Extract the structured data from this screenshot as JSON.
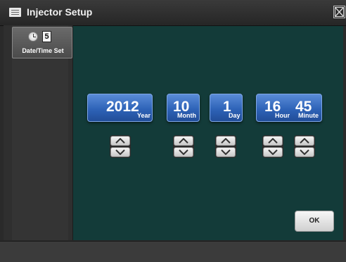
{
  "window": {
    "title": "Injector Setup"
  },
  "sidebar": {
    "items": [
      {
        "label": "Date/Time Set",
        "calendar_digit": "5"
      }
    ]
  },
  "datetime": {
    "year": {
      "value": "2012",
      "unit": "Year"
    },
    "month": {
      "value": "10",
      "unit": "Month"
    },
    "day": {
      "value": "1",
      "unit": "Day"
    },
    "hour": {
      "value": "16",
      "unit": "Hour"
    },
    "minute": {
      "value": "45",
      "unit": "Minute"
    }
  },
  "actions": {
    "ok_label": "OK"
  },
  "colors": {
    "main_background": "#133b39",
    "field_blue": "#2e63b8",
    "titlebar": "#2f2f2f"
  },
  "icons": [
    "list-icon",
    "close-icon",
    "clock-icon",
    "calendar-icon",
    "chevron-up-icon",
    "chevron-down-icon"
  ]
}
